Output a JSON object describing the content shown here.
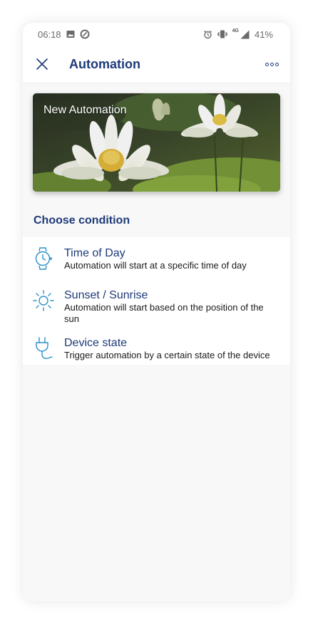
{
  "statusbar": {
    "time": "06:18",
    "battery": "41%",
    "network": "4G",
    "icons_left": [
      "image-icon",
      "data-saver-icon"
    ],
    "icons_right": [
      "alarm-icon",
      "vibrate-icon",
      "signal-icon"
    ]
  },
  "header": {
    "title": "Automation",
    "close_icon": "close-icon",
    "more_icon": "more-icon"
  },
  "banner": {
    "title": "New Automation"
  },
  "section": {
    "title": "Choose condition"
  },
  "conditions": [
    {
      "title": "Time of Day",
      "description": "Automation will start at a specific time of day",
      "icon": "watch-icon"
    },
    {
      "title": "Sunset / Sunrise",
      "description": "Automation will start based on the position of the sun",
      "icon": "sun-icon"
    },
    {
      "title": "Device state",
      "description": "Trigger automation by a certain state of the device",
      "icon": "plug-icon"
    }
  ],
  "colors": {
    "accent": "#1d3a78",
    "icon_blue": "#2a90c8",
    "background": "#f8f8f8"
  }
}
